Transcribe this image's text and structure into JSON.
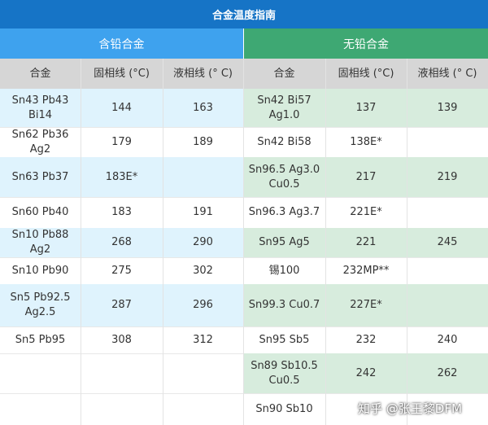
{
  "title": "合金温度指南",
  "groups": {
    "leaded": "含铅合金",
    "lead_free": "无铅合金"
  },
  "headers": {
    "leaded": [
      "合金",
      "固相线 (°C)",
      "液相线 (° C)"
    ],
    "lead_free": [
      "合金",
      "固相线 (°C)",
      "液相线 (° C)"
    ]
  },
  "colors": {
    "title_bg": "#1674c6",
    "leaded_header": "#3ea2ee",
    "lead_free_header": "#3ea873",
    "column_header": "#d6d6d6",
    "leaded_row_highlight": "#dff3fd",
    "lead_free_row_highlight": "#d7ecdd"
  },
  "rows": [
    {
      "leaded": [
        "Sn43 Pb43 Bi14",
        "144",
        "163"
      ],
      "lead_free": [
        "Sn42 Bi57 Ag1.0",
        "137",
        "139"
      ]
    },
    {
      "leaded": [
        "Sn62 Pb36 Ag2",
        "179",
        "189"
      ],
      "lead_free": [
        "Sn42 Bi58",
        "138E*",
        ""
      ]
    },
    {
      "leaded": [
        "Sn63 Pb37",
        "183E*",
        ""
      ],
      "lead_free": [
        "Sn96.5 Ag3.0 Cu0.5",
        "217",
        "219"
      ]
    },
    {
      "leaded": [
        "Sn60 Pb40",
        "183",
        "191"
      ],
      "lead_free": [
        "Sn96.3 Ag3.7",
        "221E*",
        ""
      ]
    },
    {
      "leaded": [
        "Sn10 Pb88 Ag2",
        "268",
        "290"
      ],
      "lead_free": [
        "Sn95 Ag5",
        "221",
        "245"
      ]
    },
    {
      "leaded": [
        "Sn10 Pb90",
        "275",
        "302"
      ],
      "lead_free": [
        "锡100",
        "232MP**",
        ""
      ]
    },
    {
      "leaded": [
        "Sn5 Pb92.5 Ag2.5",
        "287",
        "296"
      ],
      "lead_free": [
        "Sn99.3 Cu0.7",
        "227E*",
        ""
      ]
    },
    {
      "leaded": [
        "Sn5 Pb95",
        "308",
        "312"
      ],
      "lead_free": [
        "Sn95 Sb5",
        "232",
        "240"
      ]
    },
    {
      "leaded": [
        "",
        "",
        ""
      ],
      "lead_free": [
        "Sn89 Sb10.5 Cu0.5",
        "242",
        "262"
      ]
    },
    {
      "leaded": [
        "",
        "",
        ""
      ],
      "lead_free": [
        "Sn90 Sb10",
        "",
        ""
      ]
    }
  ],
  "watermark": "知乎 @张王黎DFM"
}
